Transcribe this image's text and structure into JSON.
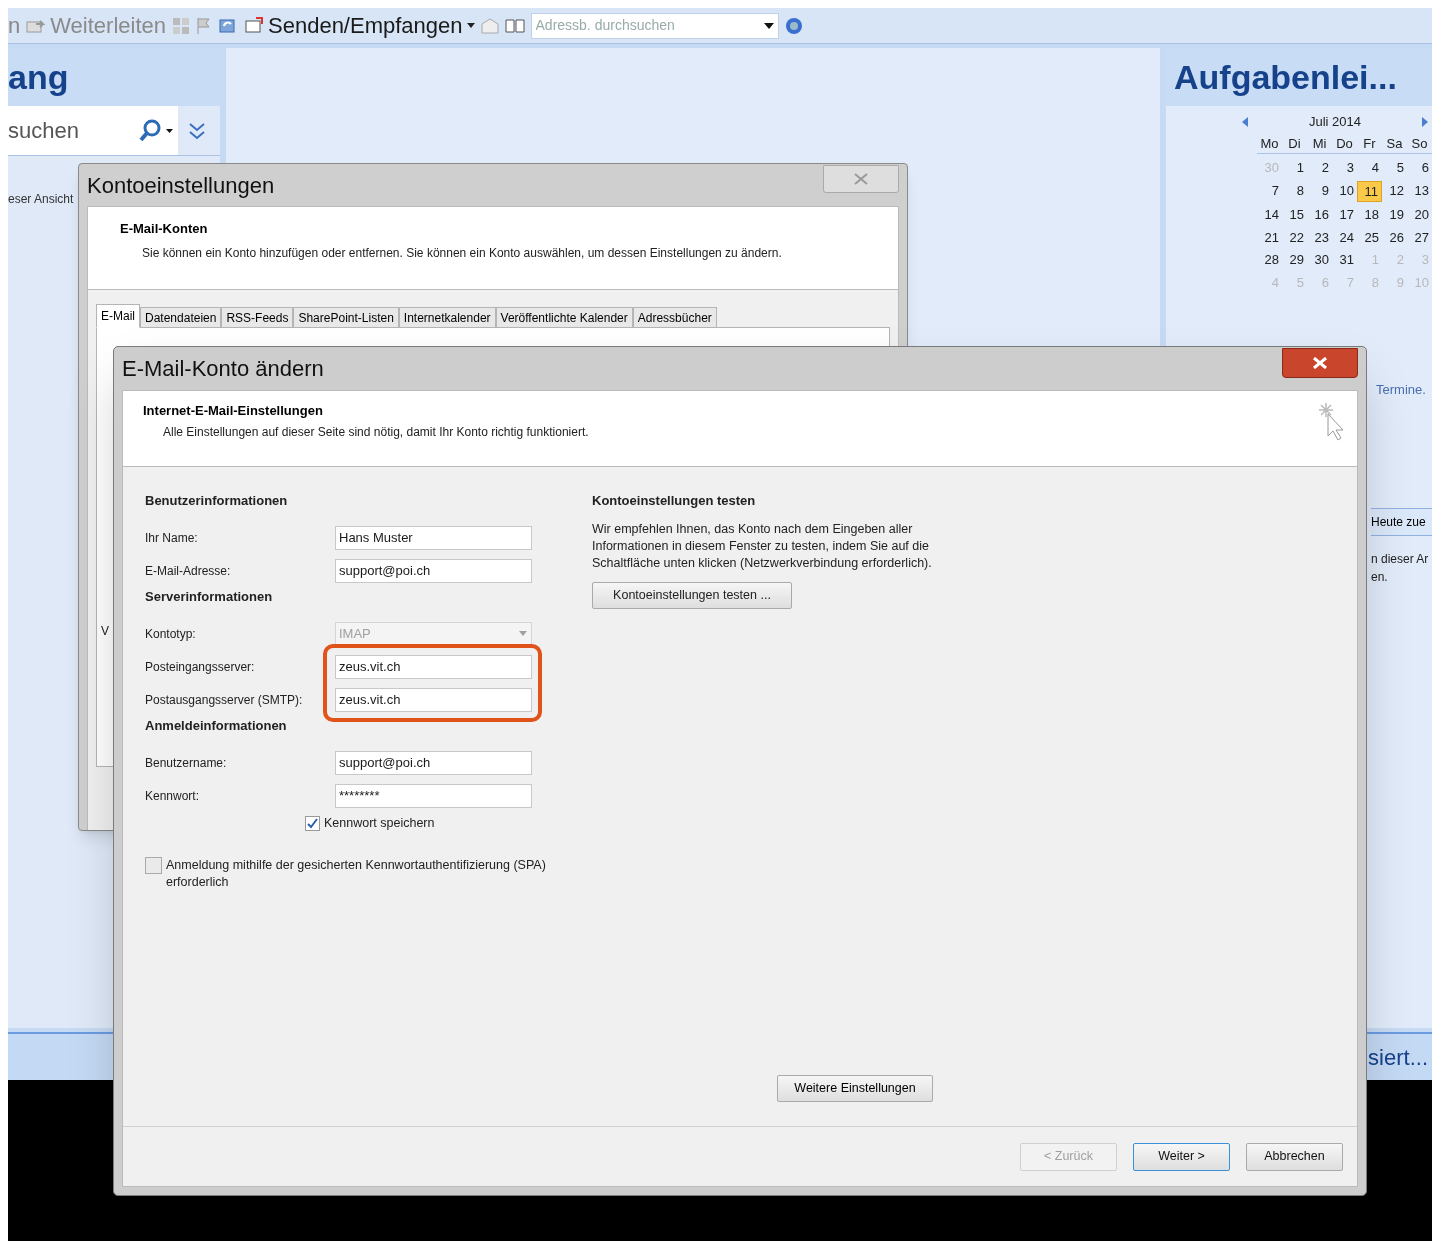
{
  "toolbar": {
    "cut_label": "n",
    "forward": "Weiterleiten",
    "send_receive": "Senden/Empfangen",
    "address_search": {
      "placeholder": "Adressb. durchsuchen"
    }
  },
  "left_pane": {
    "title": "ang",
    "search": {
      "placeholder": "suchen"
    },
    "note": "eser Ansicht"
  },
  "right_pane": {
    "title": "Aufgabenlei...",
    "calendar": {
      "month": "Juli 2014",
      "weekdays": [
        "Mo",
        "Di",
        "Mi",
        "Do",
        "Fr",
        "Sa",
        "So"
      ],
      "weeks": [
        [
          {
            "d": "30",
            "muted": true,
            "selected": false
          },
          {
            "d": "1",
            "muted": false,
            "selected": false
          },
          {
            "d": "2",
            "muted": false,
            "selected": false
          },
          {
            "d": "3",
            "muted": false,
            "selected": false
          },
          {
            "d": "4",
            "muted": false,
            "selected": false
          },
          {
            "d": "5",
            "muted": false,
            "selected": false
          },
          {
            "d": "6",
            "muted": false,
            "selected": false
          }
        ],
        [
          {
            "d": "7",
            "muted": false,
            "selected": false
          },
          {
            "d": "8",
            "muted": false,
            "selected": false
          },
          {
            "d": "9",
            "muted": false,
            "selected": false
          },
          {
            "d": "10",
            "muted": false,
            "selected": false
          },
          {
            "d": "11",
            "muted": false,
            "selected": true
          },
          {
            "d": "12",
            "muted": false,
            "selected": false
          },
          {
            "d": "13",
            "muted": false,
            "selected": false
          }
        ],
        [
          {
            "d": "14",
            "muted": false,
            "selected": false
          },
          {
            "d": "15",
            "muted": false,
            "selected": false
          },
          {
            "d": "16",
            "muted": false,
            "selected": false
          },
          {
            "d": "17",
            "muted": false,
            "selected": false
          },
          {
            "d": "18",
            "muted": false,
            "selected": false
          },
          {
            "d": "19",
            "muted": false,
            "selected": false
          },
          {
            "d": "20",
            "muted": false,
            "selected": false
          }
        ],
        [
          {
            "d": "21",
            "muted": false,
            "selected": false
          },
          {
            "d": "22",
            "muted": false,
            "selected": false
          },
          {
            "d": "23",
            "muted": false,
            "selected": false
          },
          {
            "d": "24",
            "muted": false,
            "selected": false
          },
          {
            "d": "25",
            "muted": false,
            "selected": false
          },
          {
            "d": "26",
            "muted": false,
            "selected": false
          },
          {
            "d": "27",
            "muted": false,
            "selected": false
          }
        ],
        [
          {
            "d": "28",
            "muted": false,
            "selected": false
          },
          {
            "d": "29",
            "muted": false,
            "selected": false
          },
          {
            "d": "30",
            "muted": false,
            "selected": false
          },
          {
            "d": "31",
            "muted": false,
            "selected": false
          },
          {
            "d": "1",
            "muted": true,
            "selected": false
          },
          {
            "d": "2",
            "muted": true,
            "selected": false
          },
          {
            "d": "3",
            "muted": true,
            "selected": false
          }
        ],
        [
          {
            "d": "4",
            "muted": true,
            "selected": false
          },
          {
            "d": "5",
            "muted": true,
            "selected": false
          },
          {
            "d": "6",
            "muted": true,
            "selected": false
          },
          {
            "d": "7",
            "muted": true,
            "selected": false
          },
          {
            "d": "8",
            "muted": true,
            "selected": false
          },
          {
            "d": "9",
            "muted": true,
            "selected": false
          },
          {
            "d": "10",
            "muted": true,
            "selected": false
          }
        ]
      ]
    },
    "fragments": [
      "Termine.",
      "Heute zue",
      "n dieser Ar",
      "en."
    ],
    "bottom_label": "siert..."
  },
  "dialog_accounts": {
    "title": "Kontoeinstellungen",
    "heading": "E-Mail-Konten",
    "description": "Sie können ein Konto hinzufügen oder entfernen. Sie können ein Konto auswählen, um dessen Einstellungen zu ändern.",
    "tabs": [
      {
        "label": "E-Mail",
        "selected": true
      },
      {
        "label": "Datendateien",
        "selected": false
      },
      {
        "label": "RSS-Feeds",
        "selected": false
      },
      {
        "label": "SharePoint-Listen",
        "selected": false
      },
      {
        "label": "Internetkalender",
        "selected": false
      },
      {
        "label": "Veröffentlichte Kalender",
        "selected": false
      },
      {
        "label": "Adressbücher",
        "selected": false
      }
    ],
    "fragment": "V"
  },
  "dialog_edit": {
    "title": "E-Mail-Konto ändern",
    "heading": "Internet-E-Mail-Einstellungen",
    "description": "Alle Einstellungen auf dieser Seite sind nötig, damit Ihr Konto richtig funktioniert.",
    "sections": [
      {
        "title": "Benutzerinformationen",
        "fields": [
          {
            "kind": "text",
            "label": "Ihr Name:",
            "value": "Hans Muster",
            "disabled": false,
            "highlighted": false
          },
          {
            "kind": "text",
            "label": "E-Mail-Adresse:",
            "value": "support@poi.ch",
            "disabled": false,
            "highlighted": false
          }
        ]
      },
      {
        "title": "Serverinformationen",
        "fields": [
          {
            "kind": "select",
            "label": "Kontotyp:",
            "value": "IMAP",
            "disabled": true,
            "highlighted": false
          },
          {
            "kind": "text",
            "label": "Posteingangsserver:",
            "value": "zeus.vit.ch",
            "disabled": false,
            "highlighted": true
          },
          {
            "kind": "text",
            "label": "Postausgangsserver (SMTP):",
            "value": "zeus.vit.ch",
            "disabled": false,
            "highlighted": true
          }
        ]
      },
      {
        "title": "Anmeldeinformationen",
        "fields": [
          {
            "kind": "text",
            "label": "Benutzername:",
            "value": "support@poi.ch",
            "disabled": false,
            "highlighted": false
          },
          {
            "kind": "password",
            "label": "Kennwort:",
            "value": "********",
            "disabled": false,
            "highlighted": false
          }
        ]
      }
    ],
    "save_password": {
      "label": "Kennwort speichern",
      "checked": true
    },
    "spa": {
      "label": "Anmeldung mithilfe der gesicherten Kennwortauthentifizierung (SPA) erforderlich",
      "checked": false
    },
    "test": {
      "title": "Kontoeinstellungen testen",
      "text": "Wir empfehlen Ihnen, das Konto nach dem Eingeben aller Informationen in diesem Fenster zu testen, indem Sie auf die Schaltfläche unten klicken (Netzwerkverbindung erforderlich).",
      "button": "Kontoeinstellungen testen ..."
    },
    "more_button": "Weitere Einstellungen",
    "buttons": [
      {
        "label": "< Zurück",
        "disabled": true,
        "default": false
      },
      {
        "label": "Weiter >",
        "disabled": false,
        "default": true
      },
      {
        "label": "Abbrechen",
        "disabled": false,
        "default": false
      }
    ]
  }
}
